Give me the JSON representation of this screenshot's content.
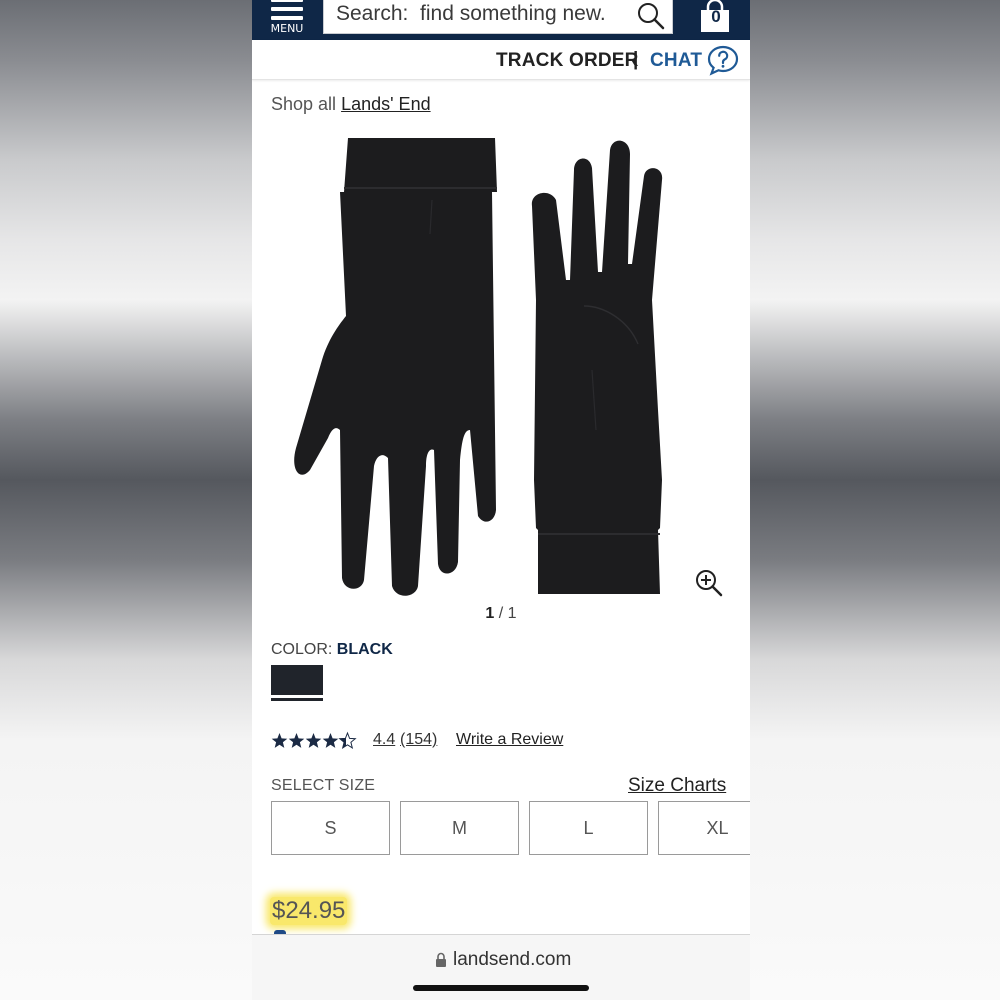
{
  "header": {
    "menu_label": "MENU",
    "search_placeholder": "Search:  find something new.",
    "cart_count": "0"
  },
  "utility": {
    "track_order": "TRACK ORDER",
    "separator": "|",
    "chat": "CHAT"
  },
  "breadcrumb": {
    "prefix": "Shop all",
    "brand": "Lands' End"
  },
  "gallery": {
    "current": "1",
    "total": "/ 1"
  },
  "color": {
    "label": "COLOR:",
    "value": "BLACK",
    "swatch_hex": "#20242b"
  },
  "reviews": {
    "stars": 4.4,
    "rating": "4.4",
    "count": "(154)",
    "write": "Write a Review"
  },
  "size": {
    "label": "SELECT SIZE",
    "charts": "Size Charts",
    "options": [
      "S",
      "M",
      "L",
      "XL"
    ]
  },
  "price": "$24.95",
  "browser": {
    "url": "landsend.com"
  },
  "colors": {
    "navy": "#0f2747",
    "link_blue": "#1f5a96",
    "highlight": "#f9e86b"
  }
}
